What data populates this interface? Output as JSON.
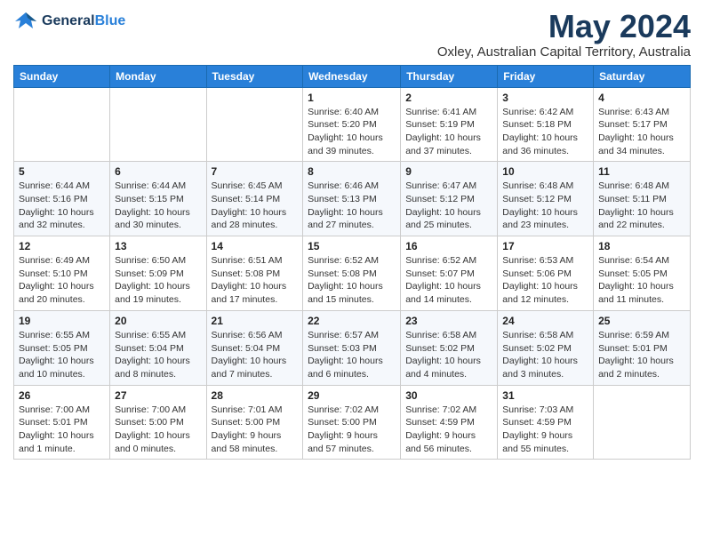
{
  "logo": {
    "line1": "General",
    "line2": "Blue"
  },
  "title": "May 2024",
  "subtitle": "Oxley, Australian Capital Territory, Australia",
  "weekdays": [
    "Sunday",
    "Monday",
    "Tuesday",
    "Wednesday",
    "Thursday",
    "Friday",
    "Saturday"
  ],
  "weeks": [
    [
      {
        "day": "",
        "info": ""
      },
      {
        "day": "",
        "info": ""
      },
      {
        "day": "",
        "info": ""
      },
      {
        "day": "1",
        "info": "Sunrise: 6:40 AM\nSunset: 5:20 PM\nDaylight: 10 hours\nand 39 minutes."
      },
      {
        "day": "2",
        "info": "Sunrise: 6:41 AM\nSunset: 5:19 PM\nDaylight: 10 hours\nand 37 minutes."
      },
      {
        "day": "3",
        "info": "Sunrise: 6:42 AM\nSunset: 5:18 PM\nDaylight: 10 hours\nand 36 minutes."
      },
      {
        "day": "4",
        "info": "Sunrise: 6:43 AM\nSunset: 5:17 PM\nDaylight: 10 hours\nand 34 minutes."
      }
    ],
    [
      {
        "day": "5",
        "info": "Sunrise: 6:44 AM\nSunset: 5:16 PM\nDaylight: 10 hours\nand 32 minutes."
      },
      {
        "day": "6",
        "info": "Sunrise: 6:44 AM\nSunset: 5:15 PM\nDaylight: 10 hours\nand 30 minutes."
      },
      {
        "day": "7",
        "info": "Sunrise: 6:45 AM\nSunset: 5:14 PM\nDaylight: 10 hours\nand 28 minutes."
      },
      {
        "day": "8",
        "info": "Sunrise: 6:46 AM\nSunset: 5:13 PM\nDaylight: 10 hours\nand 27 minutes."
      },
      {
        "day": "9",
        "info": "Sunrise: 6:47 AM\nSunset: 5:12 PM\nDaylight: 10 hours\nand 25 minutes."
      },
      {
        "day": "10",
        "info": "Sunrise: 6:48 AM\nSunset: 5:12 PM\nDaylight: 10 hours\nand 23 minutes."
      },
      {
        "day": "11",
        "info": "Sunrise: 6:48 AM\nSunset: 5:11 PM\nDaylight: 10 hours\nand 22 minutes."
      }
    ],
    [
      {
        "day": "12",
        "info": "Sunrise: 6:49 AM\nSunset: 5:10 PM\nDaylight: 10 hours\nand 20 minutes."
      },
      {
        "day": "13",
        "info": "Sunrise: 6:50 AM\nSunset: 5:09 PM\nDaylight: 10 hours\nand 19 minutes."
      },
      {
        "day": "14",
        "info": "Sunrise: 6:51 AM\nSunset: 5:08 PM\nDaylight: 10 hours\nand 17 minutes."
      },
      {
        "day": "15",
        "info": "Sunrise: 6:52 AM\nSunset: 5:08 PM\nDaylight: 10 hours\nand 15 minutes."
      },
      {
        "day": "16",
        "info": "Sunrise: 6:52 AM\nSunset: 5:07 PM\nDaylight: 10 hours\nand 14 minutes."
      },
      {
        "day": "17",
        "info": "Sunrise: 6:53 AM\nSunset: 5:06 PM\nDaylight: 10 hours\nand 12 minutes."
      },
      {
        "day": "18",
        "info": "Sunrise: 6:54 AM\nSunset: 5:05 PM\nDaylight: 10 hours\nand 11 minutes."
      }
    ],
    [
      {
        "day": "19",
        "info": "Sunrise: 6:55 AM\nSunset: 5:05 PM\nDaylight: 10 hours\nand 10 minutes."
      },
      {
        "day": "20",
        "info": "Sunrise: 6:55 AM\nSunset: 5:04 PM\nDaylight: 10 hours\nand 8 minutes."
      },
      {
        "day": "21",
        "info": "Sunrise: 6:56 AM\nSunset: 5:04 PM\nDaylight: 10 hours\nand 7 minutes."
      },
      {
        "day": "22",
        "info": "Sunrise: 6:57 AM\nSunset: 5:03 PM\nDaylight: 10 hours\nand 6 minutes."
      },
      {
        "day": "23",
        "info": "Sunrise: 6:58 AM\nSunset: 5:02 PM\nDaylight: 10 hours\nand 4 minutes."
      },
      {
        "day": "24",
        "info": "Sunrise: 6:58 AM\nSunset: 5:02 PM\nDaylight: 10 hours\nand 3 minutes."
      },
      {
        "day": "25",
        "info": "Sunrise: 6:59 AM\nSunset: 5:01 PM\nDaylight: 10 hours\nand 2 minutes."
      }
    ],
    [
      {
        "day": "26",
        "info": "Sunrise: 7:00 AM\nSunset: 5:01 PM\nDaylight: 10 hours\nand 1 minute."
      },
      {
        "day": "27",
        "info": "Sunrise: 7:00 AM\nSunset: 5:00 PM\nDaylight: 10 hours\nand 0 minutes."
      },
      {
        "day": "28",
        "info": "Sunrise: 7:01 AM\nSunset: 5:00 PM\nDaylight: 9 hours\nand 58 minutes."
      },
      {
        "day": "29",
        "info": "Sunrise: 7:02 AM\nSunset: 5:00 PM\nDaylight: 9 hours\nand 57 minutes."
      },
      {
        "day": "30",
        "info": "Sunrise: 7:02 AM\nSunset: 4:59 PM\nDaylight: 9 hours\nand 56 minutes."
      },
      {
        "day": "31",
        "info": "Sunrise: 7:03 AM\nSunset: 4:59 PM\nDaylight: 9 hours\nand 55 minutes."
      },
      {
        "day": "",
        "info": ""
      }
    ]
  ]
}
